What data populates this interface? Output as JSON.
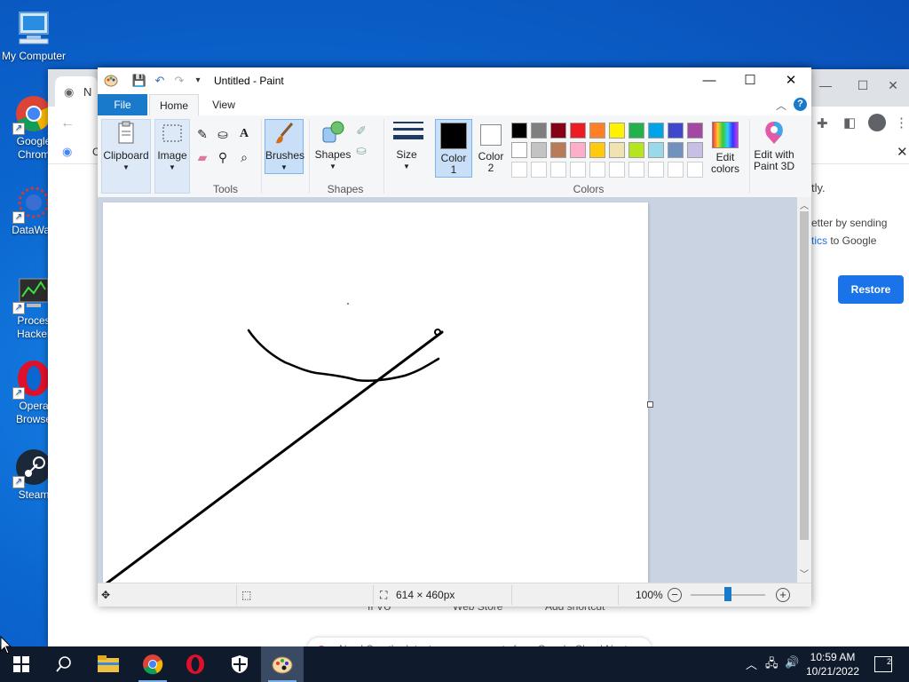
{
  "desktop": {
    "icons": [
      {
        "label": "My Computer"
      },
      {
        "label": "Google\nChrom"
      },
      {
        "label": "DataWag"
      },
      {
        "label": "Proces\nHacker"
      },
      {
        "label": "Opera\nBrowse"
      },
      {
        "label": "Steam"
      }
    ]
  },
  "chrome": {
    "tab_label": "N",
    "toolbar_partial": "C",
    "panel_text_1": "tly.",
    "panel_text_2": "etter by sending",
    "panel_text_3_link": "tics",
    "panel_text_3_rest": " to Google",
    "restore_label": "Restore",
    "bottom_items": [
      "If VU",
      "Web Store",
      "Add shortcut"
    ],
    "news_bar": "New! See the latest announcements from Google Cloud Next"
  },
  "paint": {
    "title": "Untitled - Paint",
    "tabs": {
      "file": "File",
      "home": "Home",
      "view": "View"
    },
    "help": "?",
    "ribbon": {
      "clipboard": "Clipboard",
      "image": "Image",
      "tools_group": "Tools",
      "brushes": "Brushes",
      "shapes_btn": "Shapes",
      "shapes_group": "Shapes",
      "size": "Size",
      "color1": "Color\n1",
      "color2": "Color\n2",
      "colors_group": "Colors",
      "edit_colors": "Edit\ncolors",
      "edit_paint3d": "Edit with\nPaint 3D"
    },
    "palette_row1": [
      "#000000",
      "#7f7f7f",
      "#880015",
      "#ed1c24",
      "#ff7f27",
      "#fff200",
      "#22b14c",
      "#00a2e8",
      "#3f48cc",
      "#a349a4"
    ],
    "palette_row2": [
      "#ffffff",
      "#c3c3c3",
      "#b97a57",
      "#ffaec9",
      "#ffc90e",
      "#efe4b0",
      "#b5e61d",
      "#99d9ea",
      "#7092be",
      "#c8bfe7"
    ],
    "status": {
      "dimensions": "614 × 460px",
      "zoom": "100%",
      "zoom_level_percent": 100
    }
  },
  "taskbar": {
    "time": "10:59 AM",
    "date": "10/21/2022",
    "notification_count": "2"
  }
}
